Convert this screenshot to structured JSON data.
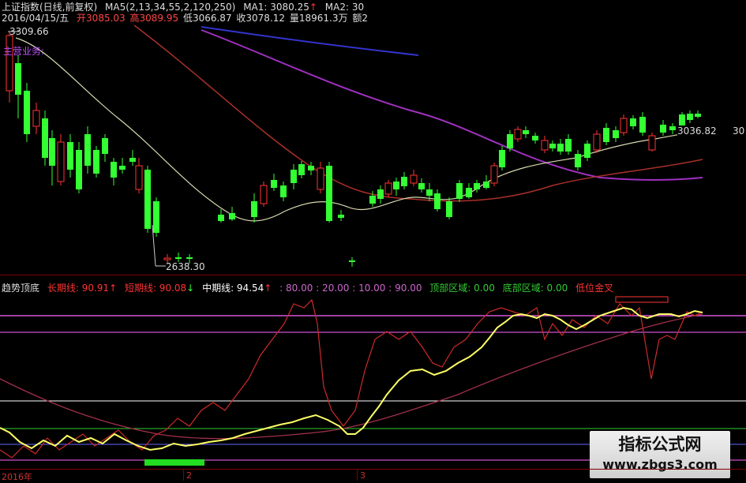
{
  "price_header": {
    "title": "上证指数(日线,前复权)",
    "ma_params": "MA5(2,13,34,55,2,120,250)",
    "ma1": "MA1: 3080.25",
    "ma2": "MA2: 30",
    "date": "2016/04/15/五",
    "open": "开3085.03",
    "high": "高3089.95",
    "low": "低3066.87",
    "close": "收3078.12",
    "volume": "量18961.3万",
    "amount": "额2"
  },
  "price_labels": {
    "high_mark": "3309.66",
    "low_mark": "2638.30",
    "last_price": "3036.82",
    "right_cut": "30",
    "main_business": "主营业务:"
  },
  "indicator_header": {
    "name": "趋势顶底",
    "long_line": "长期线: 90.91",
    "short_line": "短期线: 90.08",
    "mid_line": "中期线: 94.54",
    "levels": ": 80.00 : 20.00 : 10.00 : 90.00",
    "top_zone": "顶部区域: 0.00",
    "bottom_zone": "底部区域: 0.00",
    "low_cross": "低位金叉"
  },
  "x_axis": {
    "labels": [
      "2016年",
      "2",
      "3"
    ]
  },
  "watermark": {
    "line1": "指标公式网",
    "line2": "www.zbgs3.com"
  },
  "colors": {
    "up_candle": "#ff3333",
    "down_candle": "#33ff33",
    "ma_short": "#d8d8b0",
    "ma_mid": "#b0302a",
    "ma_long": "#a030c0",
    "ma_longest": "#3030c0",
    "long_line": "#cc2a2a",
    "short_line": "#ffff66",
    "mid_line": "#a0304a"
  }
}
